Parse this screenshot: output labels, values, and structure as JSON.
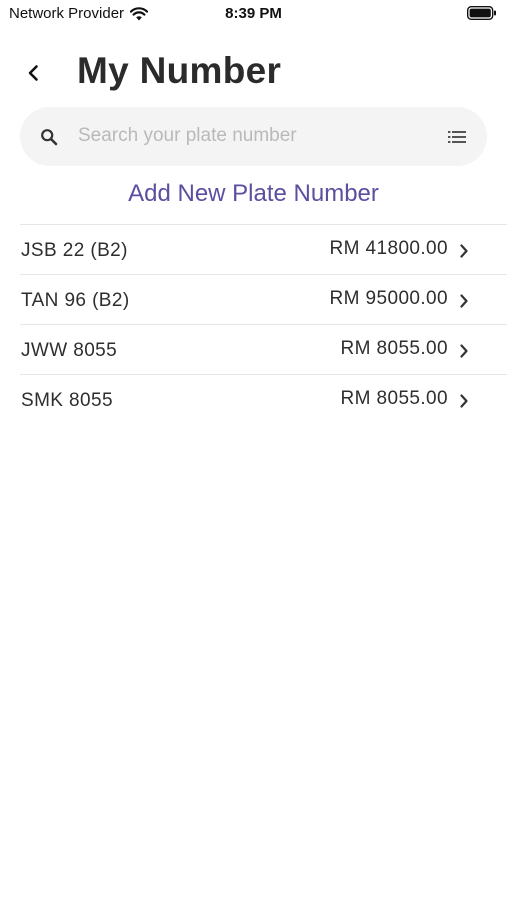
{
  "status_bar": {
    "carrier": "Network Provider",
    "time": "8:39 PM",
    "icons": [
      "wifi-icon",
      "battery-icon"
    ]
  },
  "header": {
    "title": "My Number",
    "back_icon": "chevron-left-icon"
  },
  "search": {
    "placeholder": "Search your plate number",
    "value": "",
    "icons": [
      "search-icon",
      "list-filter-icon"
    ]
  },
  "add_link": "Add New Plate Number",
  "plates": [
    {
      "number": "JSB 22 (B2)",
      "price": "RM 41800.00"
    },
    {
      "number": "TAN 96 (B2)",
      "price": "RM 95000.00"
    },
    {
      "number": "JWW 8055",
      "price": "RM 8055.00"
    },
    {
      "number": "SMK 8055",
      "price": "RM 8055.00"
    }
  ],
  "colors": {
    "accent": "#5c4ea0",
    "search_background": "#f4f4f4",
    "divider": "#e6e6e6",
    "text": "#2e2e2e",
    "placeholder": "#b9b9b9"
  }
}
